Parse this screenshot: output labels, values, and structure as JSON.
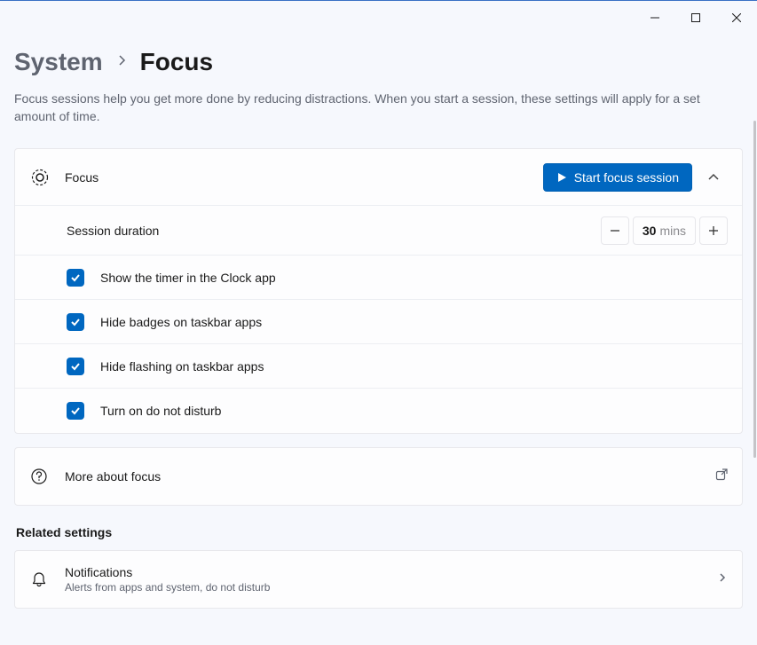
{
  "window": {
    "minimize_name": "minimize",
    "maximize_name": "maximize",
    "close_name": "close"
  },
  "breadcrumb": {
    "parent": "System",
    "current": "Focus"
  },
  "description": "Focus sessions help you get more done by reducing distractions. When you start a session, these settings will apply for a set amount of time.",
  "focus": {
    "title": "Focus",
    "start_button": "Start focus session",
    "duration_label": "Session duration",
    "duration_value": "30",
    "duration_unit": "mins",
    "options": [
      "Show the timer in the Clock app",
      "Hide badges on taskbar apps",
      "Hide flashing on taskbar apps",
      "Turn on do not disturb"
    ]
  },
  "more_link": "More about focus",
  "related": {
    "heading": "Related settings",
    "notifications_title": "Notifications",
    "notifications_sub": "Alerts from apps and system, do not disturb"
  }
}
